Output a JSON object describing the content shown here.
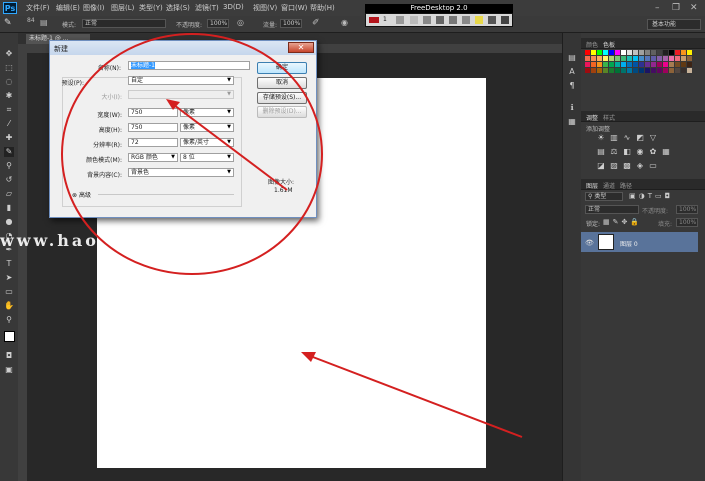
{
  "app": {
    "logo": "Ps"
  },
  "menu": [
    "文件(F)",
    "编辑(E)",
    "图像(I)",
    "图层(L)",
    "类型(Y)",
    "选择(S)",
    "滤镜(T)",
    "3D(D)",
    "视图(V)",
    "窗口(W)",
    "帮助(H)"
  ],
  "options_bar": {
    "brush_size": "84",
    "mode_label": "模式:",
    "mode_value": "正常",
    "opacity_label": "不透明度:",
    "opacity_value": "100%",
    "flow_label": "流量:",
    "flow_value": "100%"
  },
  "floating_toolbar": {
    "title": "FreeDesktop 2.0",
    "size_value": "1"
  },
  "workspace": {
    "value": "基本功能"
  },
  "document_tab": {
    "label": "未标题-1 @ ..."
  },
  "watermark": {
    "text": "www.hao"
  },
  "dialog": {
    "title": "新建",
    "name_label": "名称(N):",
    "name_value": "未标题-1",
    "preset_label": "预设(P):",
    "preset_value": "自定",
    "size_label": "大小(I):",
    "size_value": "",
    "width_label": "宽度(W):",
    "width_value": "750",
    "width_unit": "像素",
    "height_label": "高度(H):",
    "height_value": "750",
    "height_unit": "像素",
    "resolution_label": "分辨率(R):",
    "resolution_value": "72",
    "resolution_unit": "像素/英寸",
    "color_mode_label": "颜色模式(M):",
    "color_mode_value": "RGB 颜色",
    "bit_depth_value": "8 位",
    "background_label": "背景内容(C):",
    "background_value": "背景色",
    "advanced_label": "高级",
    "ok_label": "确定",
    "cancel_label": "取消",
    "save_preset_label": "存储预设(S)...",
    "delete_preset_label": "删除预设(D)...",
    "image_size_label": "图像大小:",
    "image_size_value": "1.61M"
  },
  "panels": {
    "color_tabs": [
      "颜色",
      "色板"
    ],
    "adjust_tabs": [
      "调整",
      "样式"
    ],
    "adjust_hint": "添加调整",
    "layers_tabs": [
      "图层",
      "通道",
      "路径"
    ],
    "kind_value": "类型",
    "blend_value": "正常",
    "opacity_label": "不透明度:",
    "opacity_value": "100%",
    "lock_label": "锁定:",
    "fill_label": "填充:",
    "fill_value": "100%",
    "layer_name": "图层 0"
  },
  "colors": {
    "annotation": "#d42020",
    "layer_selected": "#59739a",
    "canvas": "#ffffff"
  },
  "swatch_colors": [
    "#ff0000",
    "#ffff00",
    "#00ff00",
    "#00ffff",
    "#0000ff",
    "#ff00ff",
    "#ffffff",
    "#e0e0e0",
    "#c0c0c0",
    "#a0a0a0",
    "#808080",
    "#606060",
    "#404040",
    "#202020",
    "#000000",
    "#ed1c24",
    "#f7941d",
    "#fff200",
    "#f26c4f",
    "#f68e55",
    "#fbaf5c",
    "#fff467",
    "#acd372",
    "#7cc576",
    "#3bb878",
    "#1abbb4",
    "#00bff3",
    "#438ccb",
    "#5574b9",
    "#605ca8",
    "#855fa8",
    "#a763a8",
    "#f06ea9",
    "#f26d7d",
    "#c69c6d",
    "#8c6239",
    "#ed145b",
    "#f26522",
    "#f7941d",
    "#39b54a",
    "#00a651",
    "#00a99d",
    "#00aeef",
    "#0072bc",
    "#0054a6",
    "#2e3192",
    "#662d91",
    "#92278f",
    "#9e005d",
    "#ec008c",
    "#a67c52",
    "#754c24",
    "#603913",
    "#3c2415",
    "#9e0b0f",
    "#a0410d",
    "#a36209",
    "#598527",
    "#197b30",
    "#007236",
    "#00746b",
    "#0076a3",
    "#004a80",
    "#003471",
    "#1b1464",
    "#440e62",
    "#630460",
    "#9e005d",
    "#8c6239",
    "#534741",
    "#362f2d",
    "#c7b299"
  ]
}
